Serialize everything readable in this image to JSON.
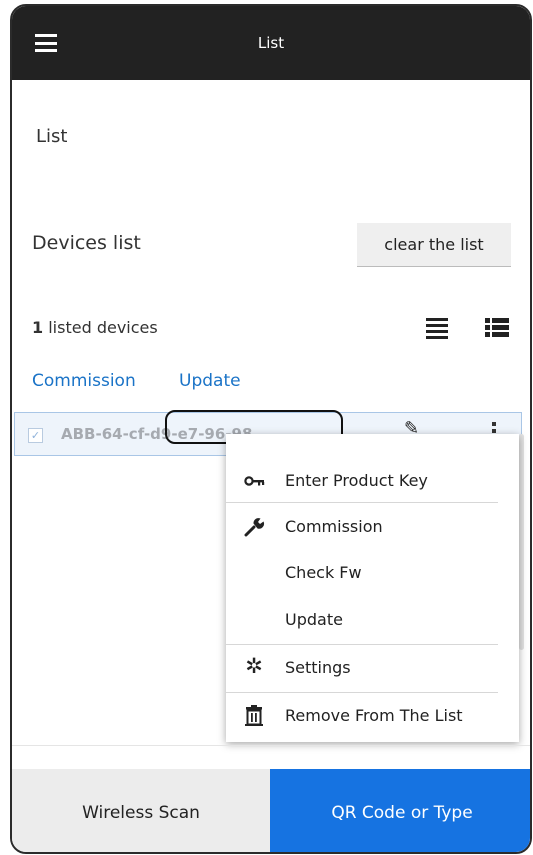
{
  "appbar": {
    "title": "List",
    "menu_icon": "hamburger-icon"
  },
  "section_title": "List",
  "devices": {
    "heading": "Devices list",
    "clear_label": "clear the list",
    "count": "1",
    "count_suffix": " listed devices",
    "actions": {
      "commission": "Commission",
      "update": "Update"
    },
    "items": [
      {
        "name": "ABB-64-cf-d9-e7-96-98",
        "checked": true
      }
    ]
  },
  "context_menu": {
    "items": [
      {
        "label": "Enter Product Key",
        "icon": "key-icon"
      },
      {
        "label": "Commission",
        "icon": "wrench-icon"
      },
      {
        "label": "Check Fw",
        "icon": ""
      },
      {
        "label": "Update",
        "icon": ""
      },
      {
        "label": "Settings",
        "icon": "gear-icon"
      },
      {
        "label": "Remove From The List",
        "icon": "trash-icon"
      }
    ]
  },
  "bottom": {
    "wireless_label": "Wireless Scan",
    "qr_label": "QR Code or Type"
  },
  "colors": {
    "appbar": "#222222",
    "accent": "#1673e1",
    "link": "#1a73c7"
  }
}
